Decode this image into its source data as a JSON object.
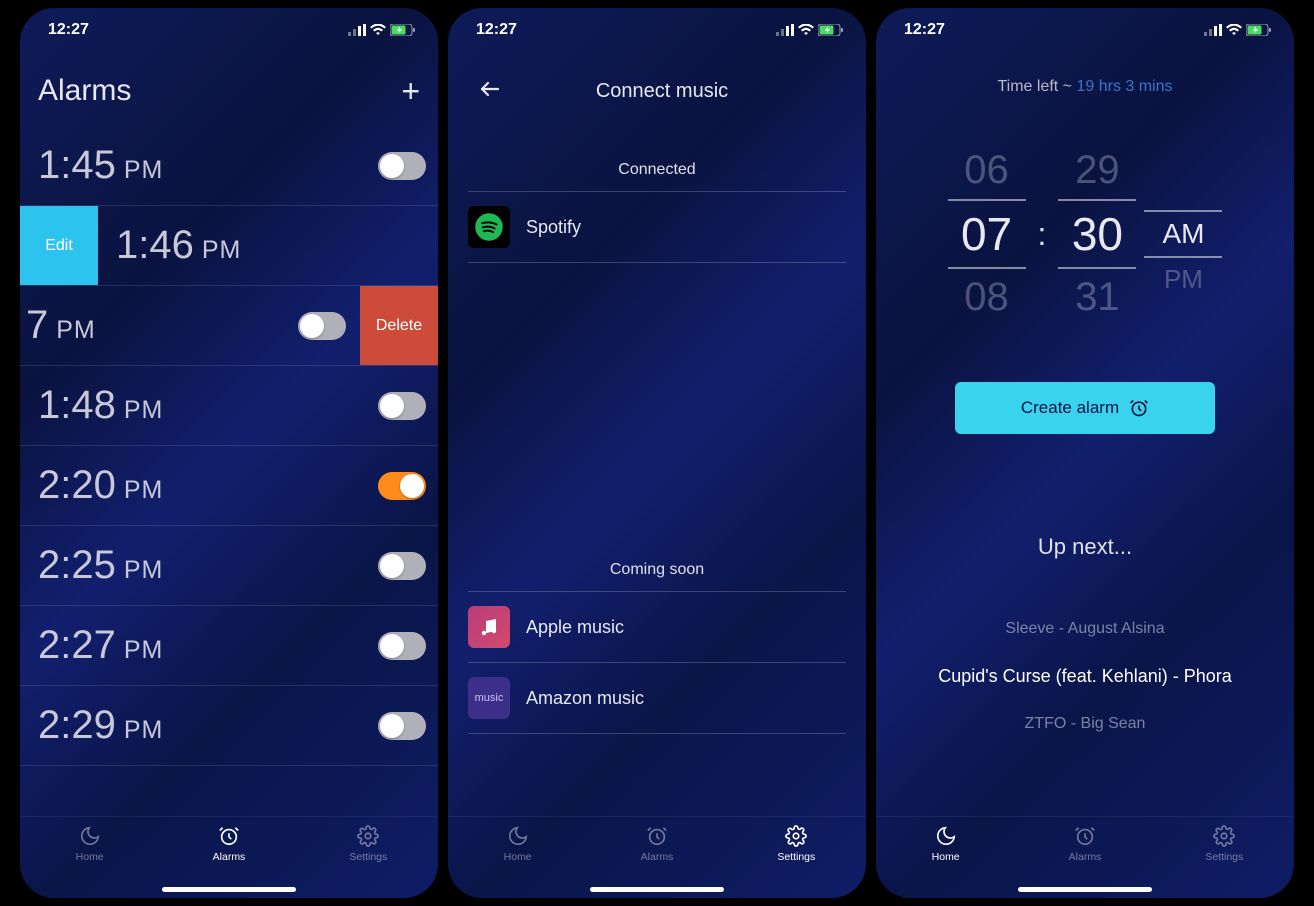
{
  "status": {
    "time": "12:27"
  },
  "tabs": {
    "home": "Home",
    "alarms": "Alarms",
    "settings": "Settings"
  },
  "screen1": {
    "title": "Alarms",
    "edit_label": "Edit",
    "delete_label": "Delete",
    "alarms": [
      {
        "time": "1:45",
        "ampm": "PM",
        "on": false
      },
      {
        "time": "1:46",
        "ampm": "PM",
        "on": false
      },
      {
        "time": "7",
        "ampm": "PM",
        "on": false,
        "partial": true
      },
      {
        "time": "1:48",
        "ampm": "PM",
        "on": false
      },
      {
        "time": "2:20",
        "ampm": "PM",
        "on": true
      },
      {
        "time": "2:25",
        "ampm": "PM",
        "on": false
      },
      {
        "time": "2:27",
        "ampm": "PM",
        "on": false
      },
      {
        "time": "2:29",
        "ampm": "PM",
        "on": false
      }
    ]
  },
  "screen2": {
    "title": "Connect music",
    "connected_label": "Connected",
    "coming_label": "Coming soon",
    "connected": [
      {
        "name": "Spotify"
      }
    ],
    "coming": [
      {
        "name": "Apple music"
      },
      {
        "name": "Amazon music"
      }
    ],
    "amazon_icon_text": "music"
  },
  "screen3": {
    "time_left_prefix": "Time left ~ ",
    "time_left_value": "19 hrs 3 mins",
    "picker": {
      "hour_prev": "06",
      "hour_sel": "07",
      "hour_next": "08",
      "min_prev": "29",
      "min_sel": "30",
      "min_next": "31",
      "am": "AM",
      "pm": "PM",
      "sep": ":"
    },
    "create_label": "Create alarm",
    "upnext": "Up next...",
    "tracks": [
      "Sleeve - August Alsina",
      "Cupid's Curse (feat. Kehlani) - Phora",
      "ZTFO - Big Sean"
    ]
  }
}
